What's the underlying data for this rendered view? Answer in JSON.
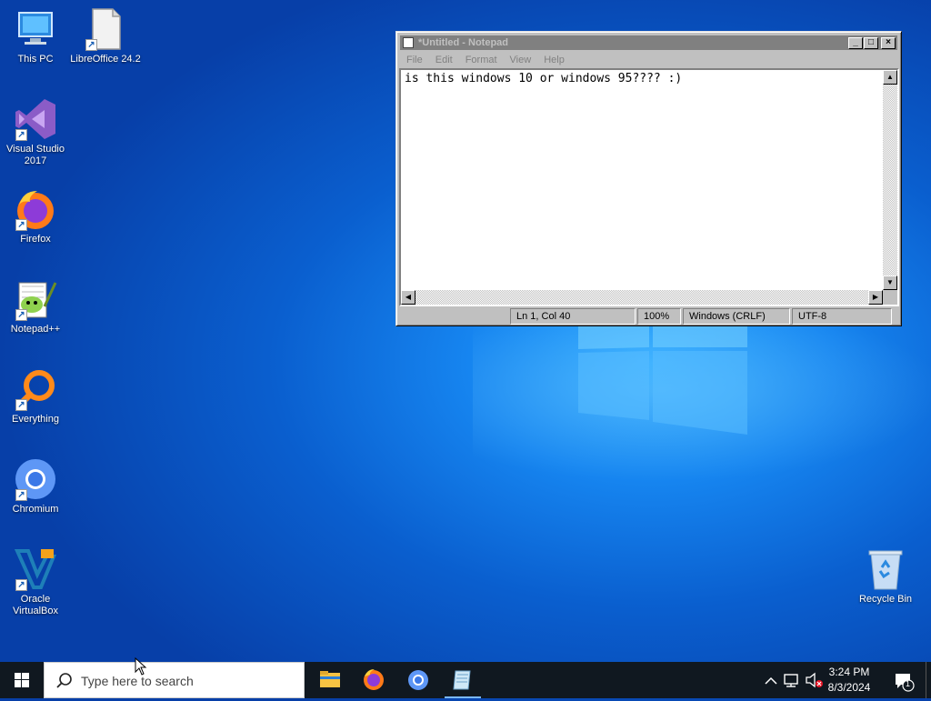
{
  "desktop": {
    "icons": [
      {
        "label": "This PC"
      },
      {
        "label": "LibreOffice 24.2"
      },
      {
        "label": "Visual Studio 2017"
      },
      {
        "label": "Firefox"
      },
      {
        "label": "Notepad++"
      },
      {
        "label": "Everything"
      },
      {
        "label": "Chromium"
      },
      {
        "label": "Oracle VirtualBox"
      },
      {
        "label": "Recycle Bin"
      }
    ]
  },
  "notepad": {
    "title": "*Untitled - Notepad",
    "menu": [
      "File",
      "Edit",
      "Format",
      "View",
      "Help"
    ],
    "content": "is this windows 10 or windows 95???? :)",
    "status": {
      "position": "Ln 1, Col 40",
      "zoom": "100%",
      "line_ending": "Windows (CRLF)",
      "encoding": "UTF-8"
    },
    "buttons": {
      "minimize": "_",
      "maximize": "□",
      "close": "×"
    }
  },
  "taskbar": {
    "search_placeholder": "Type here to search",
    "apps": [
      "file-explorer",
      "firefox",
      "chromium",
      "notepad"
    ],
    "clock": {
      "time": "3:24 PM",
      "date": "8/3/2024"
    },
    "notification_count": "1"
  },
  "colors": {
    "desktop_blue": "#0a5fcf",
    "taskbar": "#101820",
    "titlebar_inactive": "#808080",
    "win95_gray": "#c0c0c0"
  }
}
